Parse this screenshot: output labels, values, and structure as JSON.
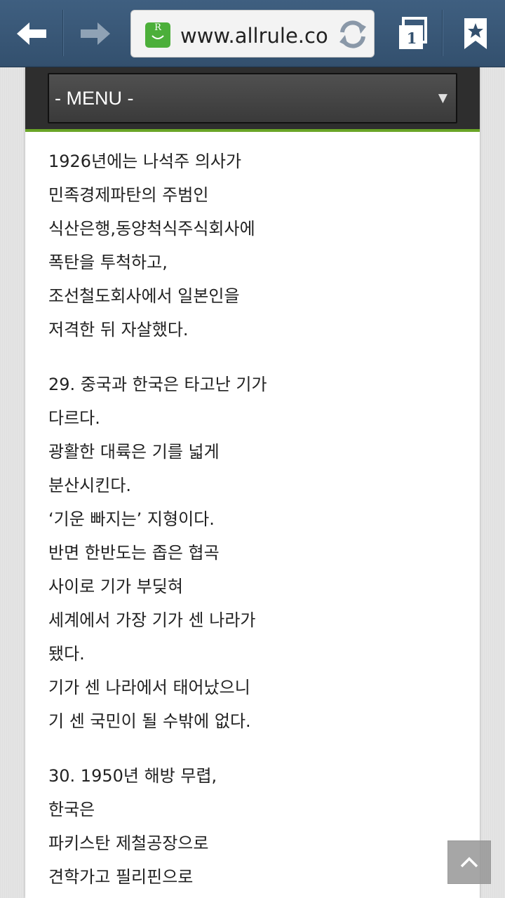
{
  "toolbar": {
    "url": "www.allrule.com",
    "site_icon_letter": "R",
    "tab_count": "1"
  },
  "menu": {
    "label": "- MENU -",
    "arrow": "▼"
  },
  "article": {
    "paragraphs": [
      {
        "lines": [
          "1926년에는 나석주 의사가",
          "민족경제파탄의 주범인",
          "식산은행,동양척식주식회사에",
          "폭탄을 투척하고,",
          "조선철도회사에서 일본인을",
          "저격한 뒤 자살했다."
        ]
      },
      {
        "lines": [
          "29. 중국과 한국은 타고난 기가",
          "다르다.",
          "광활한 대륙은 기를 넓게",
          "분산시킨다.",
          "‘기운 빠지는’ 지형이다.",
          "반면 한반도는 좁은 협곡",
          "사이로 기가 부딪혀",
          "세계에서 가장 기가 센 나라가",
          "됐다.",
          "기가 센 나라에서 태어났으니",
          "기 센 국민이 될 수밖에 없다."
        ]
      },
      {
        "lines": [
          "30. 1950년 해방 무렵,",
          "한국은",
          "파키스탄 제철공장으로",
          "견학가고 필리핀으로"
        ]
      }
    ]
  },
  "icons": {
    "back": "back-arrow-icon",
    "forward": "forward-arrow-icon",
    "reload": "reload-icon",
    "tabs": "tabs-icon",
    "bookmark": "bookmark-star-icon",
    "scroll_top": "chevron-up-icon"
  },
  "colors": {
    "toolbar": "#3a5876",
    "accent": "#6aa527",
    "menu_bg": "#2e2e2e"
  }
}
